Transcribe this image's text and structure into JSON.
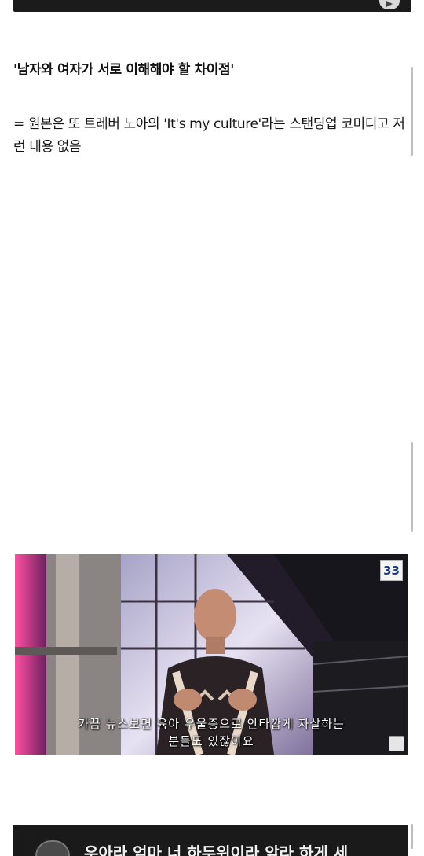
{
  "post": {
    "title": "'남자와 여자가 서로 이해해야 할 차이점'",
    "text": "= 원본은 또 트레버 노아의 'It's my culture'라는 스탠딩업 코미디고 저런 내용 없음"
  },
  "gif": {
    "badge": "33",
    "subtitle_line1": "가끔 뉴스보면 육아 우울증으로 안타깝게 자살하는",
    "subtitle_line2": "분들도 있잖아요"
  },
  "video_bottom": {
    "caption": "우아라 엄마 너 하두위이라 앞라 하게 세"
  },
  "icons": {
    "play": "play-icon"
  }
}
